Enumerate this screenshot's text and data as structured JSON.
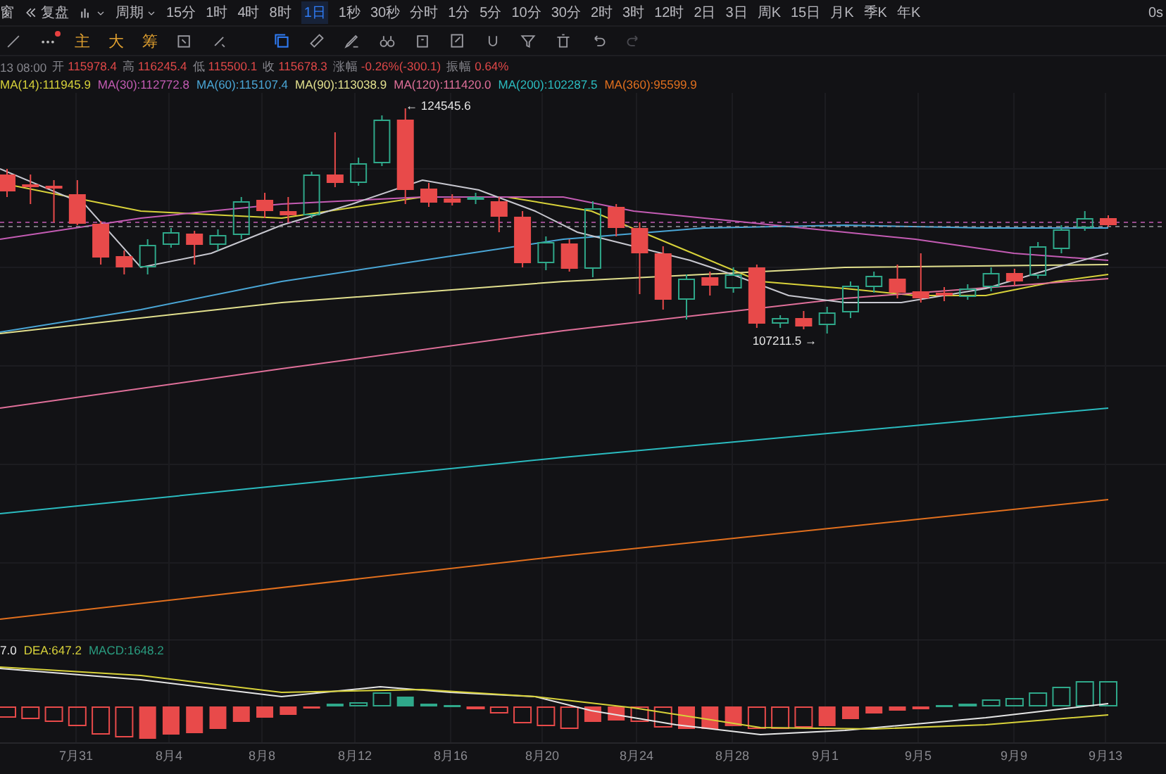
{
  "toolbar": {
    "window_tab": "窗",
    "replay": "复盘",
    "period": "周期",
    "intervals": [
      {
        "label": "15分",
        "selected": false
      },
      {
        "label": "1时",
        "selected": false
      },
      {
        "label": "4时",
        "selected": false
      },
      {
        "label": "8时",
        "selected": false
      },
      {
        "label": "1日",
        "selected": true
      },
      {
        "label": "1秒",
        "selected": false
      },
      {
        "label": "30秒",
        "selected": false
      },
      {
        "label": "分时",
        "selected": false
      },
      {
        "label": "1分",
        "selected": false
      },
      {
        "label": "5分",
        "selected": false
      },
      {
        "label": "10分",
        "selected": false
      },
      {
        "label": "30分",
        "selected": false
      },
      {
        "label": "2时",
        "selected": false
      },
      {
        "label": "3时",
        "selected": false
      },
      {
        "label": "12时",
        "selected": false
      },
      {
        "label": "2日",
        "selected": false
      },
      {
        "label": "3日",
        "selected": false
      },
      {
        "label": "周K",
        "selected": false
      },
      {
        "label": "15日",
        "selected": false
      },
      {
        "label": "月K",
        "selected": false
      },
      {
        "label": "季K",
        "selected": false
      },
      {
        "label": "年K",
        "selected": false
      }
    ],
    "timer": "0s"
  },
  "tools": {
    "indicators": [
      "主",
      "大",
      "筹"
    ]
  },
  "ohlc": {
    "time": "13 08:00",
    "fields": [
      {
        "label": "开",
        "value": "115978.4"
      },
      {
        "label": "高",
        "value": "116245.4"
      },
      {
        "label": "低",
        "value": "115500.1"
      },
      {
        "label": "收",
        "value": "115678.3"
      },
      {
        "label": "涨幅",
        "value": "-0.26%(-300.1)"
      },
      {
        "label": "振幅",
        "value": "0.64%"
      }
    ]
  },
  "moving_averages": [
    {
      "label": "MA(14):111945.9",
      "color": "#d8d23a"
    },
    {
      "label": "MA(30):112772.8",
      "color": "#c45cb4"
    },
    {
      "label": "MA(60):115107.4",
      "color": "#4aa6d6"
    },
    {
      "label": "MA(90):113038.9",
      "color": "#e2e08e"
    },
    {
      "label": "MA(120):111420.0",
      "color": "#e0709a"
    },
    {
      "label": "MA(200):102287.5",
      "color": "#2bbcc0"
    },
    {
      "label": "MA(360):95599.9",
      "color": "#e2701e"
    }
  ],
  "price_markers": [
    {
      "text": "← 124545.6",
      "kind": "high"
    },
    {
      "text": "107211.5 →",
      "kind": "low"
    }
  ],
  "macd": {
    "values": [
      {
        "label": "7.0",
        "color": "#e6e6e6"
      },
      {
        "label": "DEA:647.2",
        "color": "#d8d23a"
      },
      {
        "label": "MACD:1648.2",
        "color": "#2a9d80"
      }
    ]
  },
  "x_axis": {
    "labels": [
      "7月31",
      "8月4",
      "8月8",
      "8月12",
      "8月16",
      "8月20",
      "8月24",
      "8月28",
      "9月1",
      "9月5",
      "9月9",
      "9月13"
    ]
  }
}
